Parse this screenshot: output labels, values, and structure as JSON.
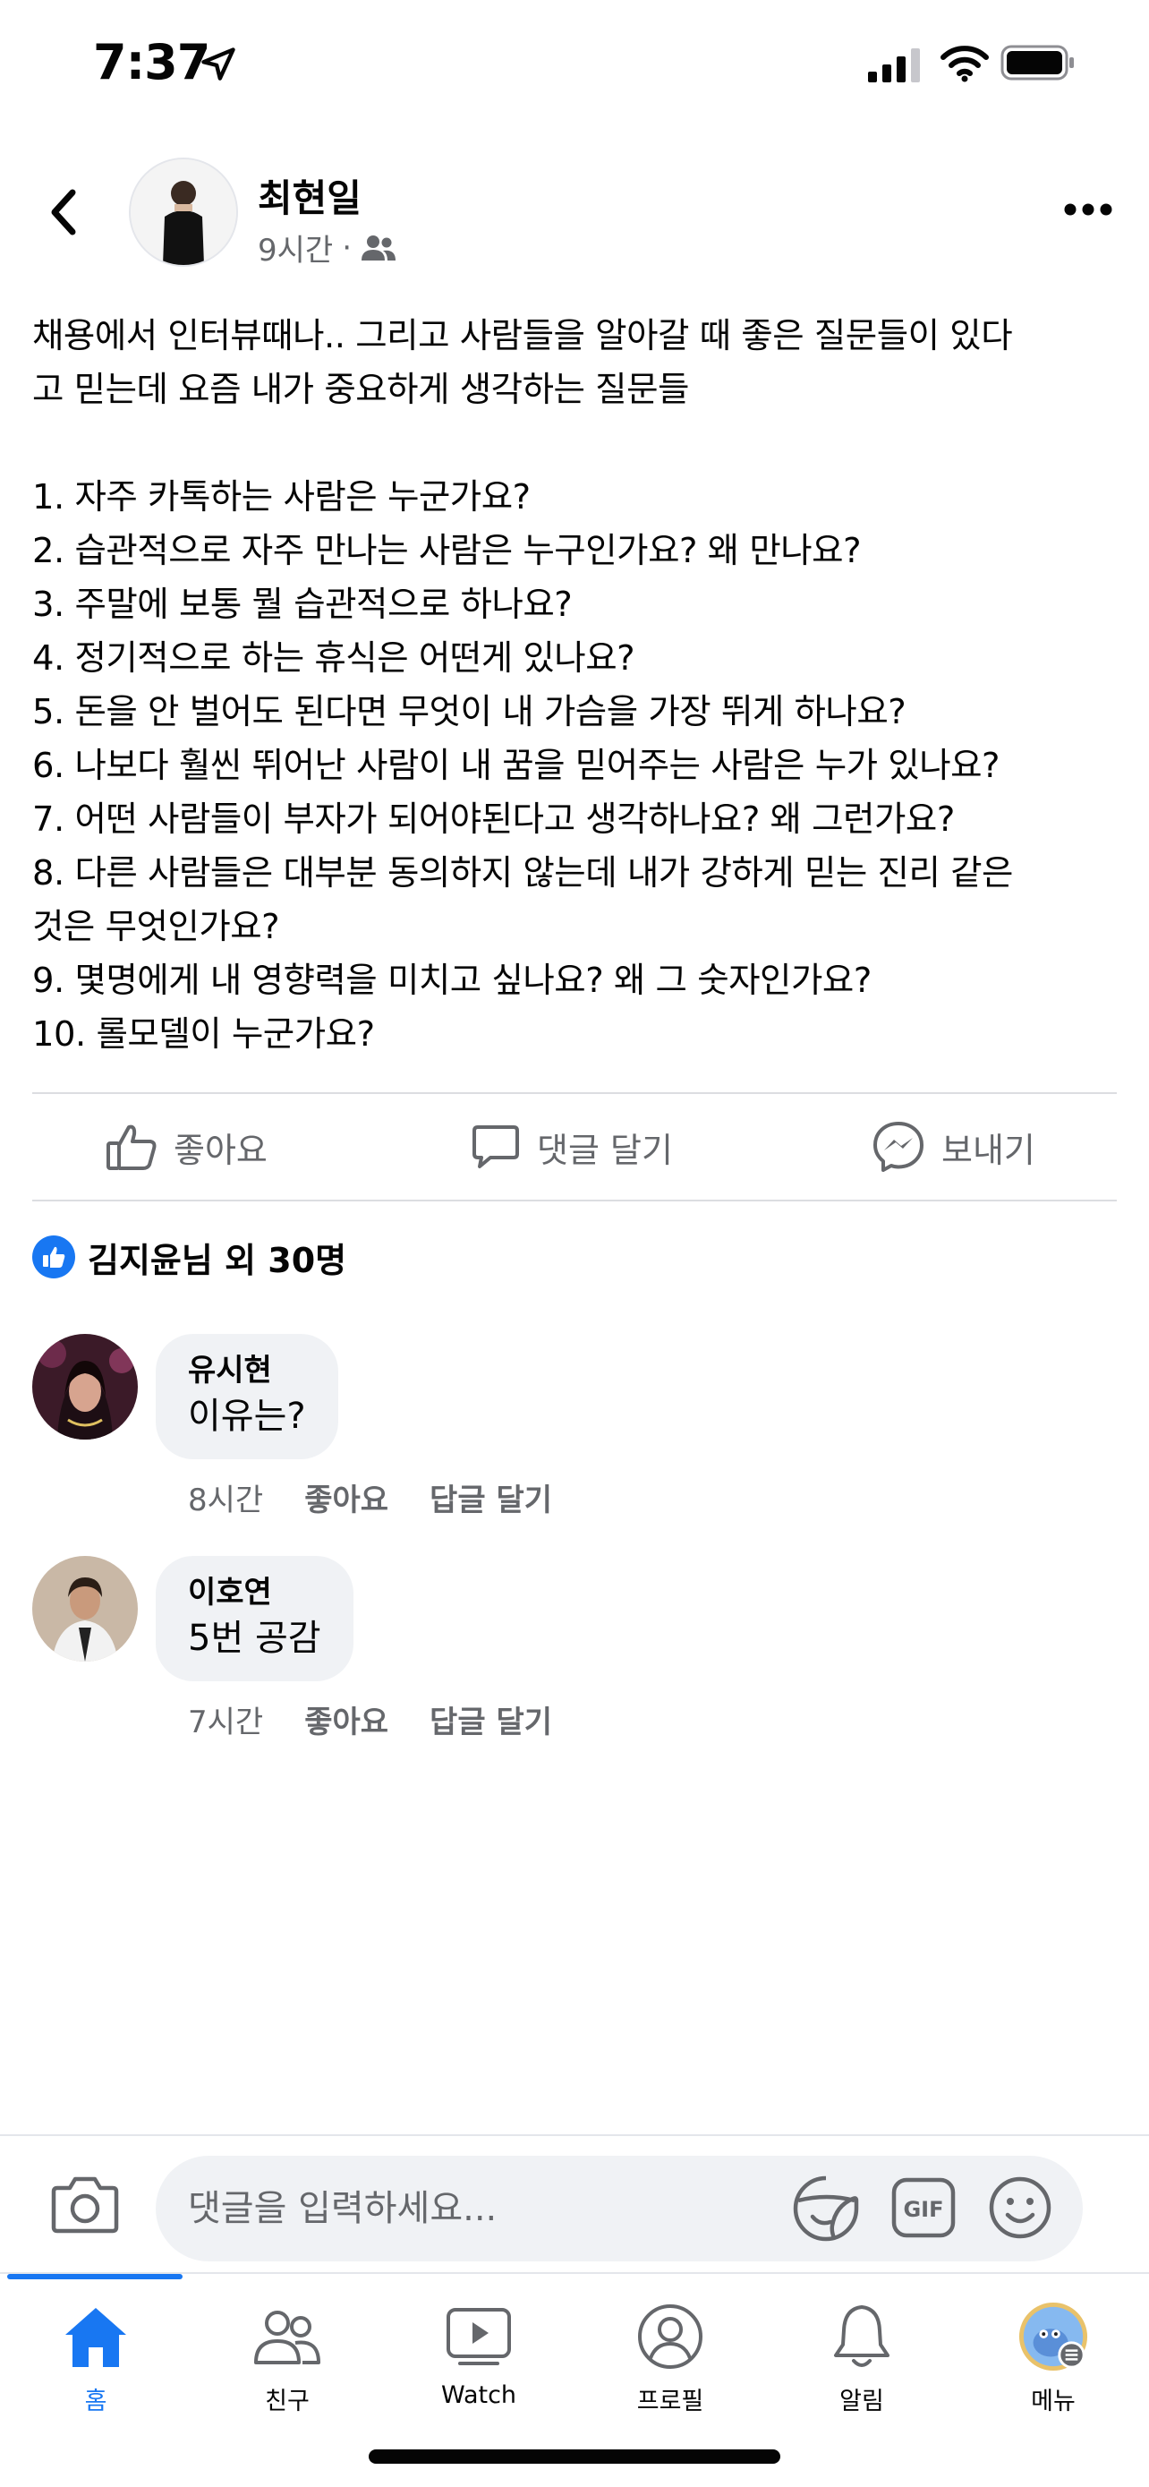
{
  "status_bar": {
    "time": "7:37"
  },
  "post": {
    "author": "최현일",
    "time": "9시간",
    "meta_separator": "·",
    "body": "채용에서 인터뷰때나.. 그리고 사람들을 알아갈 때 좋은 질문들이 있다\n고 믿는데 요즘 내가 중요하게 생각하는 질문들\n\n1. 자주 카톡하는 사람은 누군가요?\n2. 습관적으로 자주 만나는 사람은 누구인가요? 왜 만나요?\n3. 주말에 보통 뭘 습관적으로 하나요?\n4. 정기적으로 하는 휴식은 어떤게 있나요?\n5. 돈을 안 벌어도 된다면 무엇이 내 가슴을 가장 뛰게 하나요?\n6. 나보다 훨씬 뛰어난 사람이 내 꿈을 믿어주는 사람은 누가 있나요?\n7. 어떤 사람들이 부자가 되어야된다고 생각하나요? 왜 그런가요?\n8. 다른 사람들은 대부분 동의하지 않는데 내가 강하게 믿는 진리 같은\n것은 무엇인가요?\n9. 몇명에게 내 영향력을 미치고 싶나요? 왜 그 숫자인가요?\n10. 롤모델이 누군가요?"
  },
  "actions": {
    "like": "좋아요",
    "comment": "댓글 달기",
    "send": "보내기"
  },
  "reactions": {
    "summary": "김지윤님 외 30명"
  },
  "comments": [
    {
      "name": "유시현",
      "text": "이유는?",
      "time": "8시간",
      "like": "좋아요",
      "reply": "답글 달기"
    },
    {
      "name": "이호연",
      "text": "5번 공감",
      "time": "7시간",
      "like": "좋아요",
      "reply": "답글 달기"
    }
  ],
  "composer": {
    "placeholder": "댓글을 입력하세요..."
  },
  "tabs": [
    {
      "label": "홈",
      "icon": "home-icon",
      "active": true
    },
    {
      "label": "친구",
      "icon": "friends-icon",
      "active": false
    },
    {
      "label": "Watch",
      "icon": "watch-icon",
      "active": false
    },
    {
      "label": "프로필",
      "icon": "profile-icon",
      "active": false
    },
    {
      "label": "알림",
      "icon": "bell-icon",
      "active": false
    },
    {
      "label": "메뉴",
      "icon": "menu-avatar-icon",
      "active": false
    }
  ],
  "colors": {
    "accent": "#1877f2",
    "secondary_text": "#65676b",
    "bubble": "#f0f2f5"
  }
}
